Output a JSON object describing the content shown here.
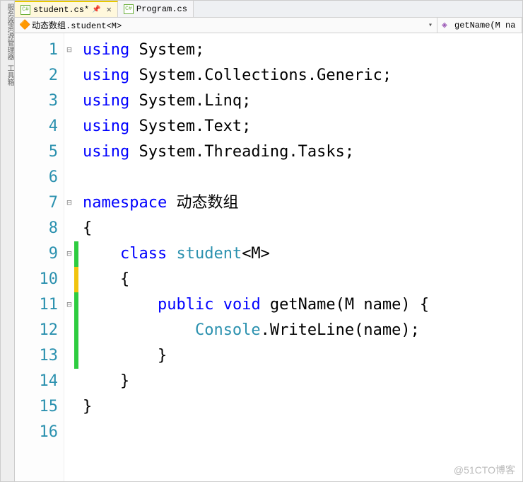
{
  "tabs": [
    {
      "label": "student.cs*",
      "active": true
    },
    {
      "label": "Program.cs",
      "active": false
    }
  ],
  "close_glyph": "✕",
  "pin_glyph": "📌",
  "nav": {
    "left": "动态数组.student<M>",
    "right": "getName(M na"
  },
  "line_numbers": [
    "1",
    "2",
    "3",
    "4",
    "5",
    "6",
    "7",
    "8",
    "9",
    "10",
    "11",
    "12",
    "13",
    "14",
    "15",
    "16"
  ],
  "folds": [
    "⊟",
    "",
    "",
    "",
    "",
    "",
    "⊟",
    "",
    "⊟",
    "",
    "⊟",
    "",
    "",
    "",
    "",
    ""
  ],
  "changes": [
    "",
    "",
    "",
    "",
    "",
    "",
    "",
    "",
    "green",
    "yellow",
    "green",
    "green",
    "green",
    "",
    "",
    ""
  ],
  "code_lines": [
    [
      {
        "c": "kw",
        "t": "using"
      },
      {
        "c": "plain",
        "t": " System;"
      }
    ],
    [
      {
        "c": "kw",
        "t": "using"
      },
      {
        "c": "plain",
        "t": " System.Collections.Generic;"
      }
    ],
    [
      {
        "c": "kw",
        "t": "using"
      },
      {
        "c": "plain",
        "t": " System.Linq;"
      }
    ],
    [
      {
        "c": "kw",
        "t": "using"
      },
      {
        "c": "plain",
        "t": " System.Text;"
      }
    ],
    [
      {
        "c": "kw",
        "t": "using"
      },
      {
        "c": "plain",
        "t": " System.Threading.Tasks;"
      }
    ],
    [
      {
        "c": "plain",
        "t": ""
      }
    ],
    [
      {
        "c": "kw",
        "t": "namespace"
      },
      {
        "c": "plain",
        "t": " 动态数组"
      }
    ],
    [
      {
        "c": "plain",
        "t": "{"
      }
    ],
    [
      {
        "c": "plain",
        "t": "    "
      },
      {
        "c": "kw",
        "t": "class"
      },
      {
        "c": "plain",
        "t": " "
      },
      {
        "c": "type",
        "t": "student"
      },
      {
        "c": "plain",
        "t": "<M>"
      }
    ],
    [
      {
        "c": "plain",
        "t": "    {"
      }
    ],
    [
      {
        "c": "plain",
        "t": "        "
      },
      {
        "c": "kw",
        "t": "public"
      },
      {
        "c": "plain",
        "t": " "
      },
      {
        "c": "kw",
        "t": "void"
      },
      {
        "c": "plain",
        "t": " getName(M name) {"
      }
    ],
    [
      {
        "c": "plain",
        "t": "            "
      },
      {
        "c": "type",
        "t": "Console"
      },
      {
        "c": "plain",
        "t": ".WriteLine(name);"
      }
    ],
    [
      {
        "c": "plain",
        "t": "        }"
      }
    ],
    [
      {
        "c": "plain",
        "t": "    }"
      }
    ],
    [
      {
        "c": "plain",
        "t": "}"
      }
    ],
    [
      {
        "c": "plain",
        "t": ""
      }
    ]
  ],
  "watermark": "@51CTO博客",
  "side_panel": "服务器资源管理器  工具箱"
}
